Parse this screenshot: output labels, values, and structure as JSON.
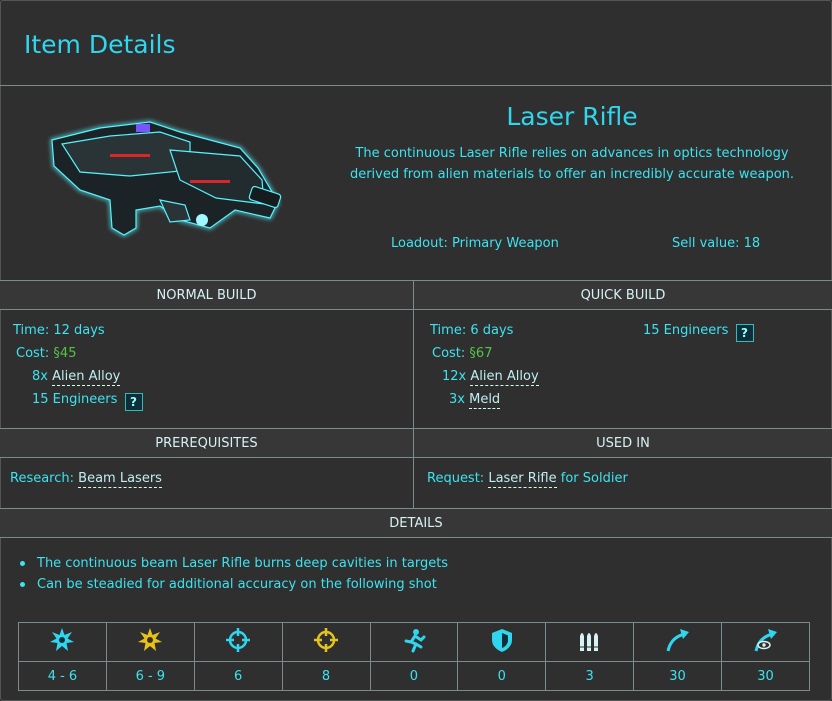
{
  "header": {
    "title": "Item Details"
  },
  "item": {
    "name": "Laser Rifle",
    "description": "The continuous Laser Rifle relies on advances in optics technology derived from alien materials to offer an incredibly accurate weapon.",
    "loadout_label": "Loadout:",
    "loadout_value": "Primary Weapon",
    "sell_label": "Sell value:",
    "sell_value": "18"
  },
  "normal_build": {
    "heading": "NORMAL BUILD",
    "time_label": "Time:",
    "time_value": "12 days",
    "cost_label": "Cost:",
    "cost_value": "§45",
    "materials": [
      {
        "qty": "8x",
        "name": "Alien Alloy"
      }
    ],
    "engineers": "15 Engineers"
  },
  "quick_build": {
    "heading": "QUICK BUILD",
    "time_label": "Time:",
    "time_value": "6 days",
    "cost_label": "Cost:",
    "cost_value": "§67",
    "materials": [
      {
        "qty": "12x",
        "name": "Alien Alloy"
      },
      {
        "qty": "3x",
        "name": "Meld"
      }
    ],
    "engineers": "15 Engineers"
  },
  "prerequisites": {
    "heading": "PREREQUISITES",
    "label": "Research:",
    "value": "Beam Lasers"
  },
  "used_in": {
    "heading": "USED IN",
    "label": "Request:",
    "value": "Laser Rifle",
    "suffix": "for Soldier"
  },
  "details": {
    "heading": "DETAILS",
    "bullets": [
      "The continuous beam Laser Rifle burns deep cavities in targets",
      "Can be steadied for additional accuracy on the following shot"
    ]
  },
  "help_icon_glyph": "?",
  "stats": [
    {
      "icon": "damage-icon",
      "value": "4 - 6"
    },
    {
      "icon": "critical-damage-icon",
      "value": "6 - 9"
    },
    {
      "icon": "aim-icon",
      "value": "6"
    },
    {
      "icon": "critical-chance-icon",
      "value": "8"
    },
    {
      "icon": "mobility-icon",
      "value": "0"
    },
    {
      "icon": "defense-icon",
      "value": "0"
    },
    {
      "icon": "ammo-icon",
      "value": "3"
    },
    {
      "icon": "range-icon",
      "value": "30"
    },
    {
      "icon": "sight-range-icon",
      "value": "30"
    }
  ],
  "colors": {
    "accent": "#3ce3f0",
    "background": "#2f2f2f",
    "cost": "#55c24a",
    "critical": "#e6c21e"
  }
}
